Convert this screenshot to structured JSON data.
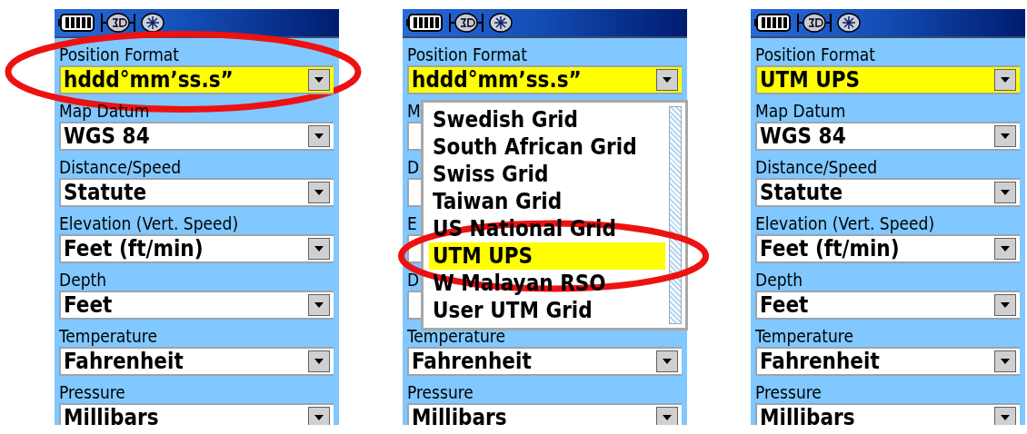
{
  "panels": [
    {
      "fields": [
        {
          "label": "Position Format",
          "value": "hddd°mm’ss.s”",
          "selected": true,
          "circled": true
        },
        {
          "label": "Map Datum",
          "value": "WGS 84",
          "selected": false,
          "circled": false
        },
        {
          "label": "Distance/Speed",
          "value": "Statute",
          "selected": false,
          "circled": false
        },
        {
          "label": "Elevation (Vert. Speed)",
          "value": "Feet (ft/min)",
          "selected": false,
          "circled": false
        },
        {
          "label": "Depth",
          "value": "Feet",
          "selected": false,
          "circled": false
        },
        {
          "label": "Temperature",
          "value": "Fahrenheit",
          "selected": false,
          "circled": false
        },
        {
          "label": "Pressure",
          "value": "Millibars",
          "selected": false,
          "circled": false
        }
      ]
    },
    {
      "fields": [
        {
          "label": "Position Format",
          "value": "hddd°mm’ss.s”",
          "selected": true,
          "circled": false
        },
        {
          "label": "M",
          "selected": false
        },
        {
          "label": "D",
          "selected": false
        },
        {
          "label": "E",
          "selected": false
        },
        {
          "label": "D",
          "selected": false
        },
        {
          "label": "Temperature",
          "value": "Fahrenheit",
          "selected": false,
          "circled": false
        },
        {
          "label": "Pressure",
          "value": "Millibars",
          "selected": false,
          "circled": false
        }
      ],
      "dropdown": {
        "options": [
          {
            "label": "Swedish Grid",
            "selected": false,
            "circled": false
          },
          {
            "label": "South African Grid",
            "selected": false,
            "circled": false
          },
          {
            "label": "Swiss Grid",
            "selected": false,
            "circled": false
          },
          {
            "label": "Taiwan Grid",
            "selected": false,
            "circled": false
          },
          {
            "label": "US National Grid",
            "selected": false,
            "circled": false
          },
          {
            "label": "UTM UPS",
            "selected": true,
            "circled": true
          },
          {
            "label": "W Malayan RSO",
            "selected": false,
            "circled": false
          },
          {
            "label": "User UTM Grid",
            "selected": false,
            "circled": false
          }
        ]
      }
    },
    {
      "fields": [
        {
          "label": "Position Format",
          "value": "UTM UPS",
          "selected": true,
          "circled": false
        },
        {
          "label": "Map Datum",
          "value": "WGS 84",
          "selected": false,
          "circled": false
        },
        {
          "label": "Distance/Speed",
          "value": "Statute",
          "selected": false,
          "circled": false
        },
        {
          "label": "Elevation (Vert. Speed)",
          "value": "Feet (ft/min)",
          "selected": false,
          "circled": false
        },
        {
          "label": "Depth",
          "value": "Feet",
          "selected": false,
          "circled": false
        },
        {
          "label": "Temperature",
          "value": "Fahrenheit",
          "selected": false,
          "circled": false
        },
        {
          "label": "Pressure",
          "value": "Millibars",
          "selected": false,
          "circled": false
        }
      ]
    }
  ]
}
